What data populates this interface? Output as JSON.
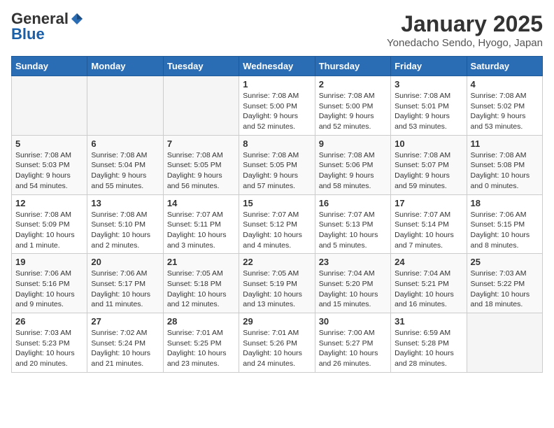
{
  "header": {
    "logo_general": "General",
    "logo_blue": "Blue",
    "month_title": "January 2025",
    "location": "Yonedacho Sendo, Hyogo, Japan"
  },
  "weekdays": [
    "Sunday",
    "Monday",
    "Tuesday",
    "Wednesday",
    "Thursday",
    "Friday",
    "Saturday"
  ],
  "weeks": [
    [
      {
        "day": "",
        "info": ""
      },
      {
        "day": "",
        "info": ""
      },
      {
        "day": "",
        "info": ""
      },
      {
        "day": "1",
        "info": "Sunrise: 7:08 AM\nSunset: 5:00 PM\nDaylight: 9 hours\nand 52 minutes."
      },
      {
        "day": "2",
        "info": "Sunrise: 7:08 AM\nSunset: 5:00 PM\nDaylight: 9 hours\nand 52 minutes."
      },
      {
        "day": "3",
        "info": "Sunrise: 7:08 AM\nSunset: 5:01 PM\nDaylight: 9 hours\nand 53 minutes."
      },
      {
        "day": "4",
        "info": "Sunrise: 7:08 AM\nSunset: 5:02 PM\nDaylight: 9 hours\nand 53 minutes."
      }
    ],
    [
      {
        "day": "5",
        "info": "Sunrise: 7:08 AM\nSunset: 5:03 PM\nDaylight: 9 hours\nand 54 minutes."
      },
      {
        "day": "6",
        "info": "Sunrise: 7:08 AM\nSunset: 5:04 PM\nDaylight: 9 hours\nand 55 minutes."
      },
      {
        "day": "7",
        "info": "Sunrise: 7:08 AM\nSunset: 5:05 PM\nDaylight: 9 hours\nand 56 minutes."
      },
      {
        "day": "8",
        "info": "Sunrise: 7:08 AM\nSunset: 5:05 PM\nDaylight: 9 hours\nand 57 minutes."
      },
      {
        "day": "9",
        "info": "Sunrise: 7:08 AM\nSunset: 5:06 PM\nDaylight: 9 hours\nand 58 minutes."
      },
      {
        "day": "10",
        "info": "Sunrise: 7:08 AM\nSunset: 5:07 PM\nDaylight: 9 hours\nand 59 minutes."
      },
      {
        "day": "11",
        "info": "Sunrise: 7:08 AM\nSunset: 5:08 PM\nDaylight: 10 hours\nand 0 minutes."
      }
    ],
    [
      {
        "day": "12",
        "info": "Sunrise: 7:08 AM\nSunset: 5:09 PM\nDaylight: 10 hours\nand 1 minute."
      },
      {
        "day": "13",
        "info": "Sunrise: 7:08 AM\nSunset: 5:10 PM\nDaylight: 10 hours\nand 2 minutes."
      },
      {
        "day": "14",
        "info": "Sunrise: 7:07 AM\nSunset: 5:11 PM\nDaylight: 10 hours\nand 3 minutes."
      },
      {
        "day": "15",
        "info": "Sunrise: 7:07 AM\nSunset: 5:12 PM\nDaylight: 10 hours\nand 4 minutes."
      },
      {
        "day": "16",
        "info": "Sunrise: 7:07 AM\nSunset: 5:13 PM\nDaylight: 10 hours\nand 5 minutes."
      },
      {
        "day": "17",
        "info": "Sunrise: 7:07 AM\nSunset: 5:14 PM\nDaylight: 10 hours\nand 7 minutes."
      },
      {
        "day": "18",
        "info": "Sunrise: 7:06 AM\nSunset: 5:15 PM\nDaylight: 10 hours\nand 8 minutes."
      }
    ],
    [
      {
        "day": "19",
        "info": "Sunrise: 7:06 AM\nSunset: 5:16 PM\nDaylight: 10 hours\nand 9 minutes."
      },
      {
        "day": "20",
        "info": "Sunrise: 7:06 AM\nSunset: 5:17 PM\nDaylight: 10 hours\nand 11 minutes."
      },
      {
        "day": "21",
        "info": "Sunrise: 7:05 AM\nSunset: 5:18 PM\nDaylight: 10 hours\nand 12 minutes."
      },
      {
        "day": "22",
        "info": "Sunrise: 7:05 AM\nSunset: 5:19 PM\nDaylight: 10 hours\nand 13 minutes."
      },
      {
        "day": "23",
        "info": "Sunrise: 7:04 AM\nSunset: 5:20 PM\nDaylight: 10 hours\nand 15 minutes."
      },
      {
        "day": "24",
        "info": "Sunrise: 7:04 AM\nSunset: 5:21 PM\nDaylight: 10 hours\nand 16 minutes."
      },
      {
        "day": "25",
        "info": "Sunrise: 7:03 AM\nSunset: 5:22 PM\nDaylight: 10 hours\nand 18 minutes."
      }
    ],
    [
      {
        "day": "26",
        "info": "Sunrise: 7:03 AM\nSunset: 5:23 PM\nDaylight: 10 hours\nand 20 minutes."
      },
      {
        "day": "27",
        "info": "Sunrise: 7:02 AM\nSunset: 5:24 PM\nDaylight: 10 hours\nand 21 minutes."
      },
      {
        "day": "28",
        "info": "Sunrise: 7:01 AM\nSunset: 5:25 PM\nDaylight: 10 hours\nand 23 minutes."
      },
      {
        "day": "29",
        "info": "Sunrise: 7:01 AM\nSunset: 5:26 PM\nDaylight: 10 hours\nand 24 minutes."
      },
      {
        "day": "30",
        "info": "Sunrise: 7:00 AM\nSunset: 5:27 PM\nDaylight: 10 hours\nand 26 minutes."
      },
      {
        "day": "31",
        "info": "Sunrise: 6:59 AM\nSunset: 5:28 PM\nDaylight: 10 hours\nand 28 minutes."
      },
      {
        "day": "",
        "info": ""
      }
    ]
  ]
}
